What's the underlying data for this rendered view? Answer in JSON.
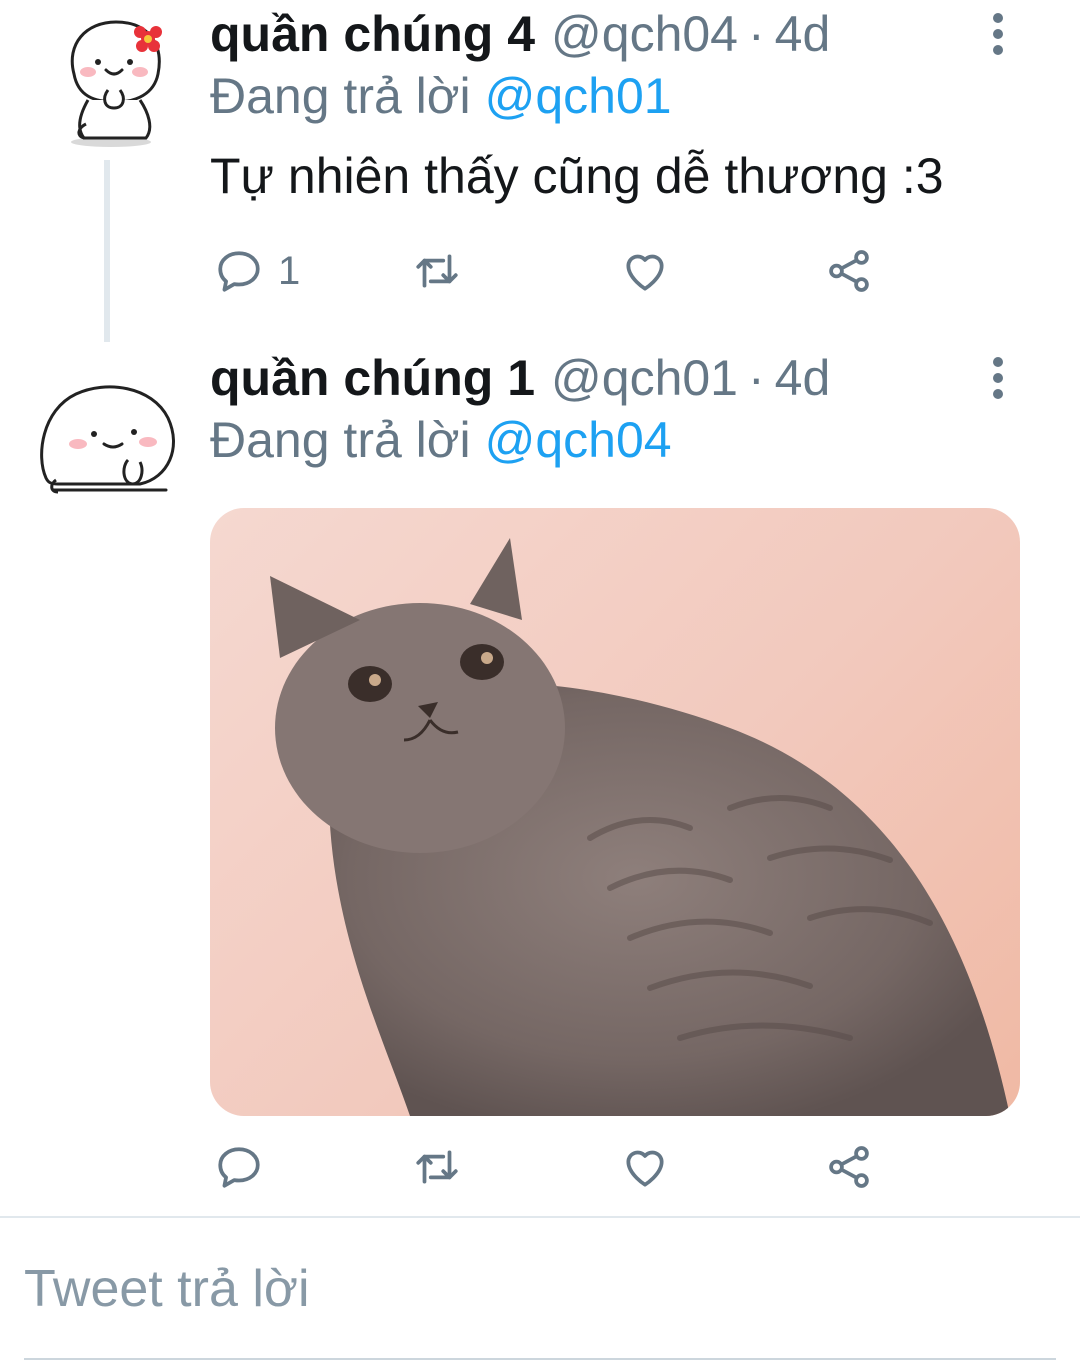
{
  "tweets": [
    {
      "display_name": "quần chúng 4",
      "handle": "@qch04",
      "separator": "·",
      "time": "4d",
      "replying_prefix": "Đang trả lời",
      "replying_to": "@qch01",
      "text": "Tự nhiên thấy cũng dễ thương :3",
      "reply_count": "1",
      "avatar_icon": "bunny-sticker-with-flower-icon"
    },
    {
      "display_name": "quần chúng 1",
      "handle": "@qch01",
      "separator": "·",
      "time": "4d",
      "replying_prefix": "Đang trả lời",
      "replying_to": "@qch04",
      "media": "photo-of-grey-cat",
      "avatar_icon": "bunny-sticker-thinking-icon"
    }
  ],
  "composer": {
    "placeholder": "Tweet trả lời"
  },
  "colors": {
    "link": "#1da1f2",
    "secondary_text": "#657786",
    "primary_text": "#14171a",
    "divider": "#e1e8ed"
  }
}
